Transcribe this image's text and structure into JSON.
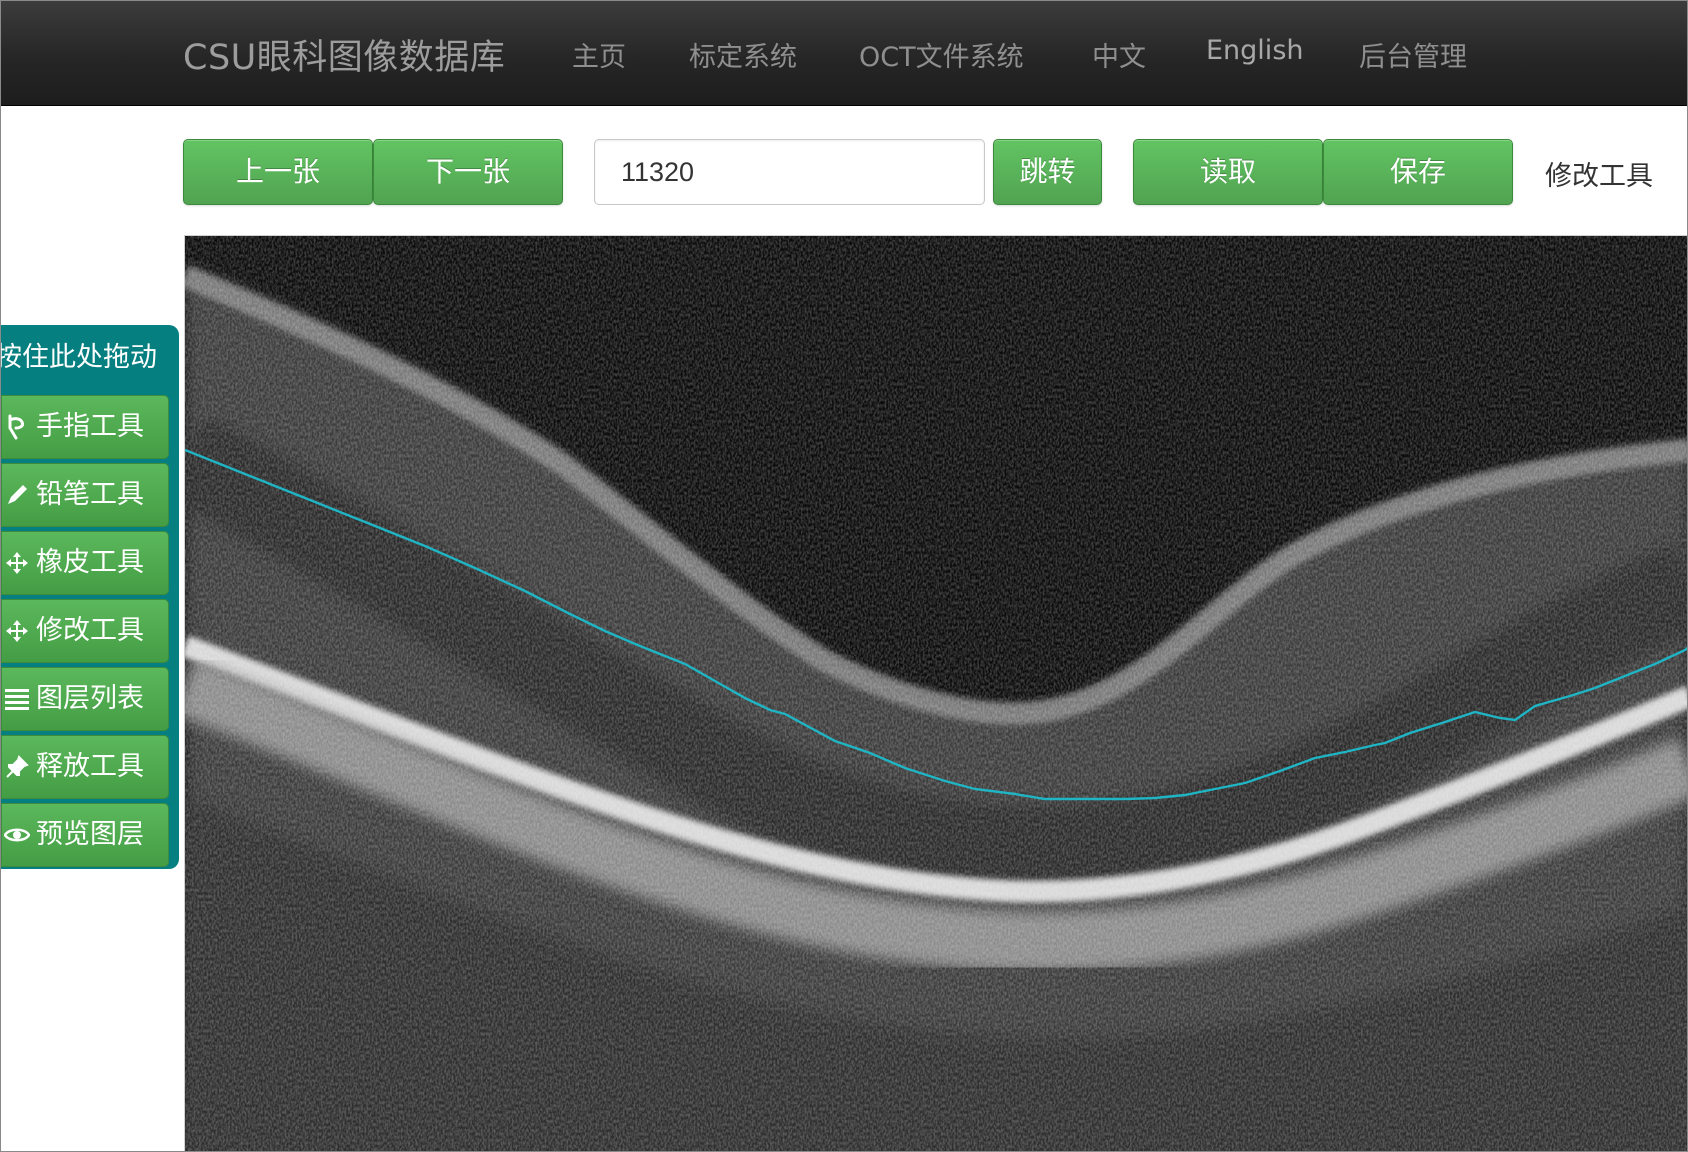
{
  "nav": {
    "brand": "CSU眼科图像数据库",
    "items": [
      "主页",
      "标定系统",
      "OCT文件系统",
      "中文",
      "English",
      "后台管理"
    ]
  },
  "toolbar": {
    "prev_label": "上一张",
    "next_label": "下一张",
    "image_number": "11320",
    "jump_label": "跳转",
    "read_label": "读取",
    "save_label": "保存",
    "current_tool": "修改工具"
  },
  "tool_panel": {
    "drag_label": "按住此处拖动",
    "tools": [
      {
        "label": "手指工具",
        "icon": "hand-pointer-icon"
      },
      {
        "label": "铅笔工具",
        "icon": "pencil-icon"
      },
      {
        "label": "橡皮工具",
        "icon": "eraser-move-icon"
      },
      {
        "label": "修改工具",
        "icon": "move-arrows-icon"
      },
      {
        "label": "图层列表",
        "icon": "list-icon"
      },
      {
        "label": "释放工具",
        "icon": "pushpin-icon"
      },
      {
        "label": "预览图层",
        "icon": "eye-icon"
      }
    ]
  },
  "colors": {
    "navbar": "#222222",
    "button_green": "#51a351",
    "panel_teal": "#067f80",
    "annotation_line": "#1fb5c4"
  }
}
